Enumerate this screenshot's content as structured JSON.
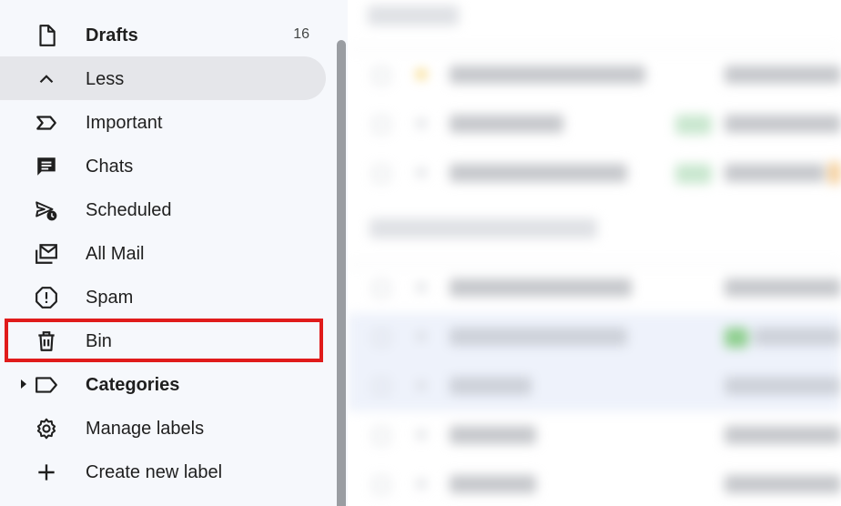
{
  "sidebar": {
    "items": [
      {
        "id": "drafts",
        "label": "Drafts",
        "count": "16",
        "icon": "draft-icon",
        "bold": true
      },
      {
        "id": "less",
        "label": "Less",
        "icon": "chevron-up-icon",
        "active": true
      },
      {
        "id": "important",
        "label": "Important",
        "icon": "important-icon"
      },
      {
        "id": "chats",
        "label": "Chats",
        "icon": "chat-icon"
      },
      {
        "id": "scheduled",
        "label": "Scheduled",
        "icon": "scheduled-send-icon"
      },
      {
        "id": "allmail",
        "label": "All Mail",
        "icon": "all-mail-icon"
      },
      {
        "id": "spam",
        "label": "Spam",
        "icon": "spam-icon"
      },
      {
        "id": "bin",
        "label": "Bin",
        "icon": "trash-icon",
        "highlighted": true
      },
      {
        "id": "categories",
        "label": "Categories",
        "icon": "label-icon",
        "bold": true,
        "expandable": true
      },
      {
        "id": "managelabels",
        "label": "Manage labels",
        "icon": "gear-icon"
      },
      {
        "id": "createlabel",
        "label": "Create new label",
        "icon": "plus-icon"
      }
    ]
  },
  "colors": {
    "sidebar_bg": "#f6f8fc",
    "active_bg": "#e5e6ea",
    "highlight_border": "#e01b1b",
    "scrollbar": "#9a9da2"
  }
}
